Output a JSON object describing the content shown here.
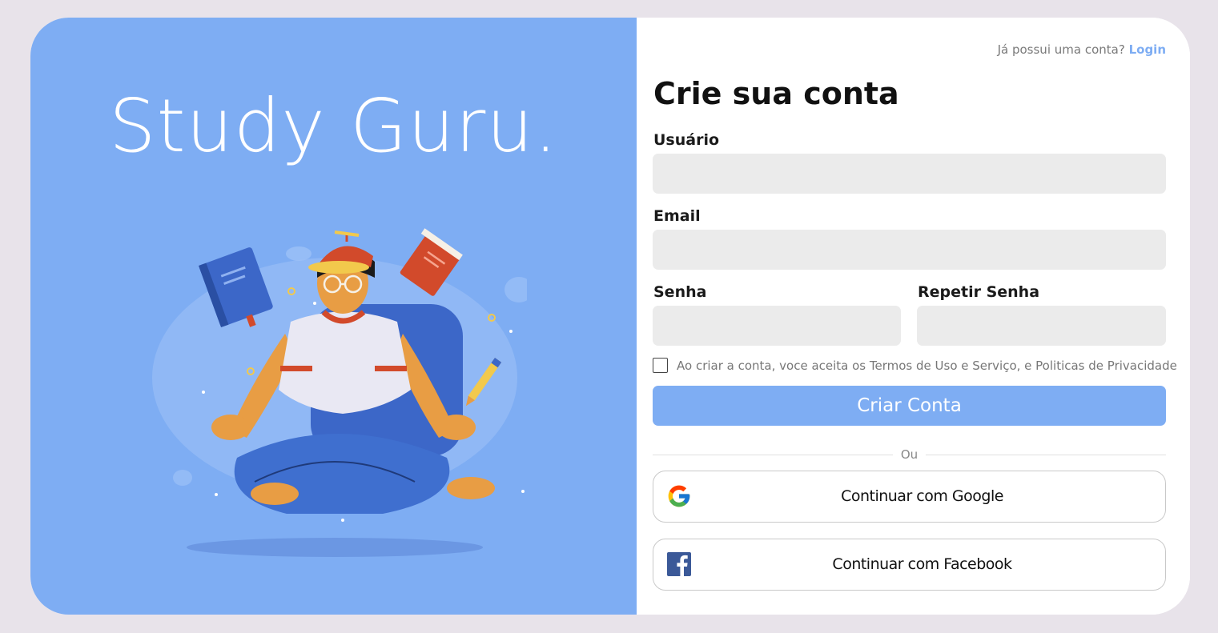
{
  "brand": {
    "name": "Study Guru."
  },
  "header": {
    "has_account_text": "Já possui uma conta?",
    "login_link": "Login"
  },
  "form": {
    "title": "Crie sua conta",
    "username_label": "Usuário",
    "username_value": "",
    "email_label": "Email",
    "email_value": "",
    "password_label": "Senha",
    "password_value": "",
    "repeat_password_label": "Repetir Senha",
    "repeat_password_value": "",
    "terms_checked": false,
    "terms_text": "Ao criar a conta, voce aceita os Termos de Uso e Serviço, e Politicas de Privacidade",
    "submit_label": "Criar Conta",
    "divider_label": "Ou"
  },
  "social": {
    "google_label": "Continuar com Google",
    "google_icon": "google-icon",
    "facebook_label": "Continuar com Facebook",
    "facebook_icon": "facebook-icon"
  },
  "colors": {
    "accent": "#7eadf3",
    "background": "#e8e3ea",
    "input_bg": "#ebebeb"
  }
}
